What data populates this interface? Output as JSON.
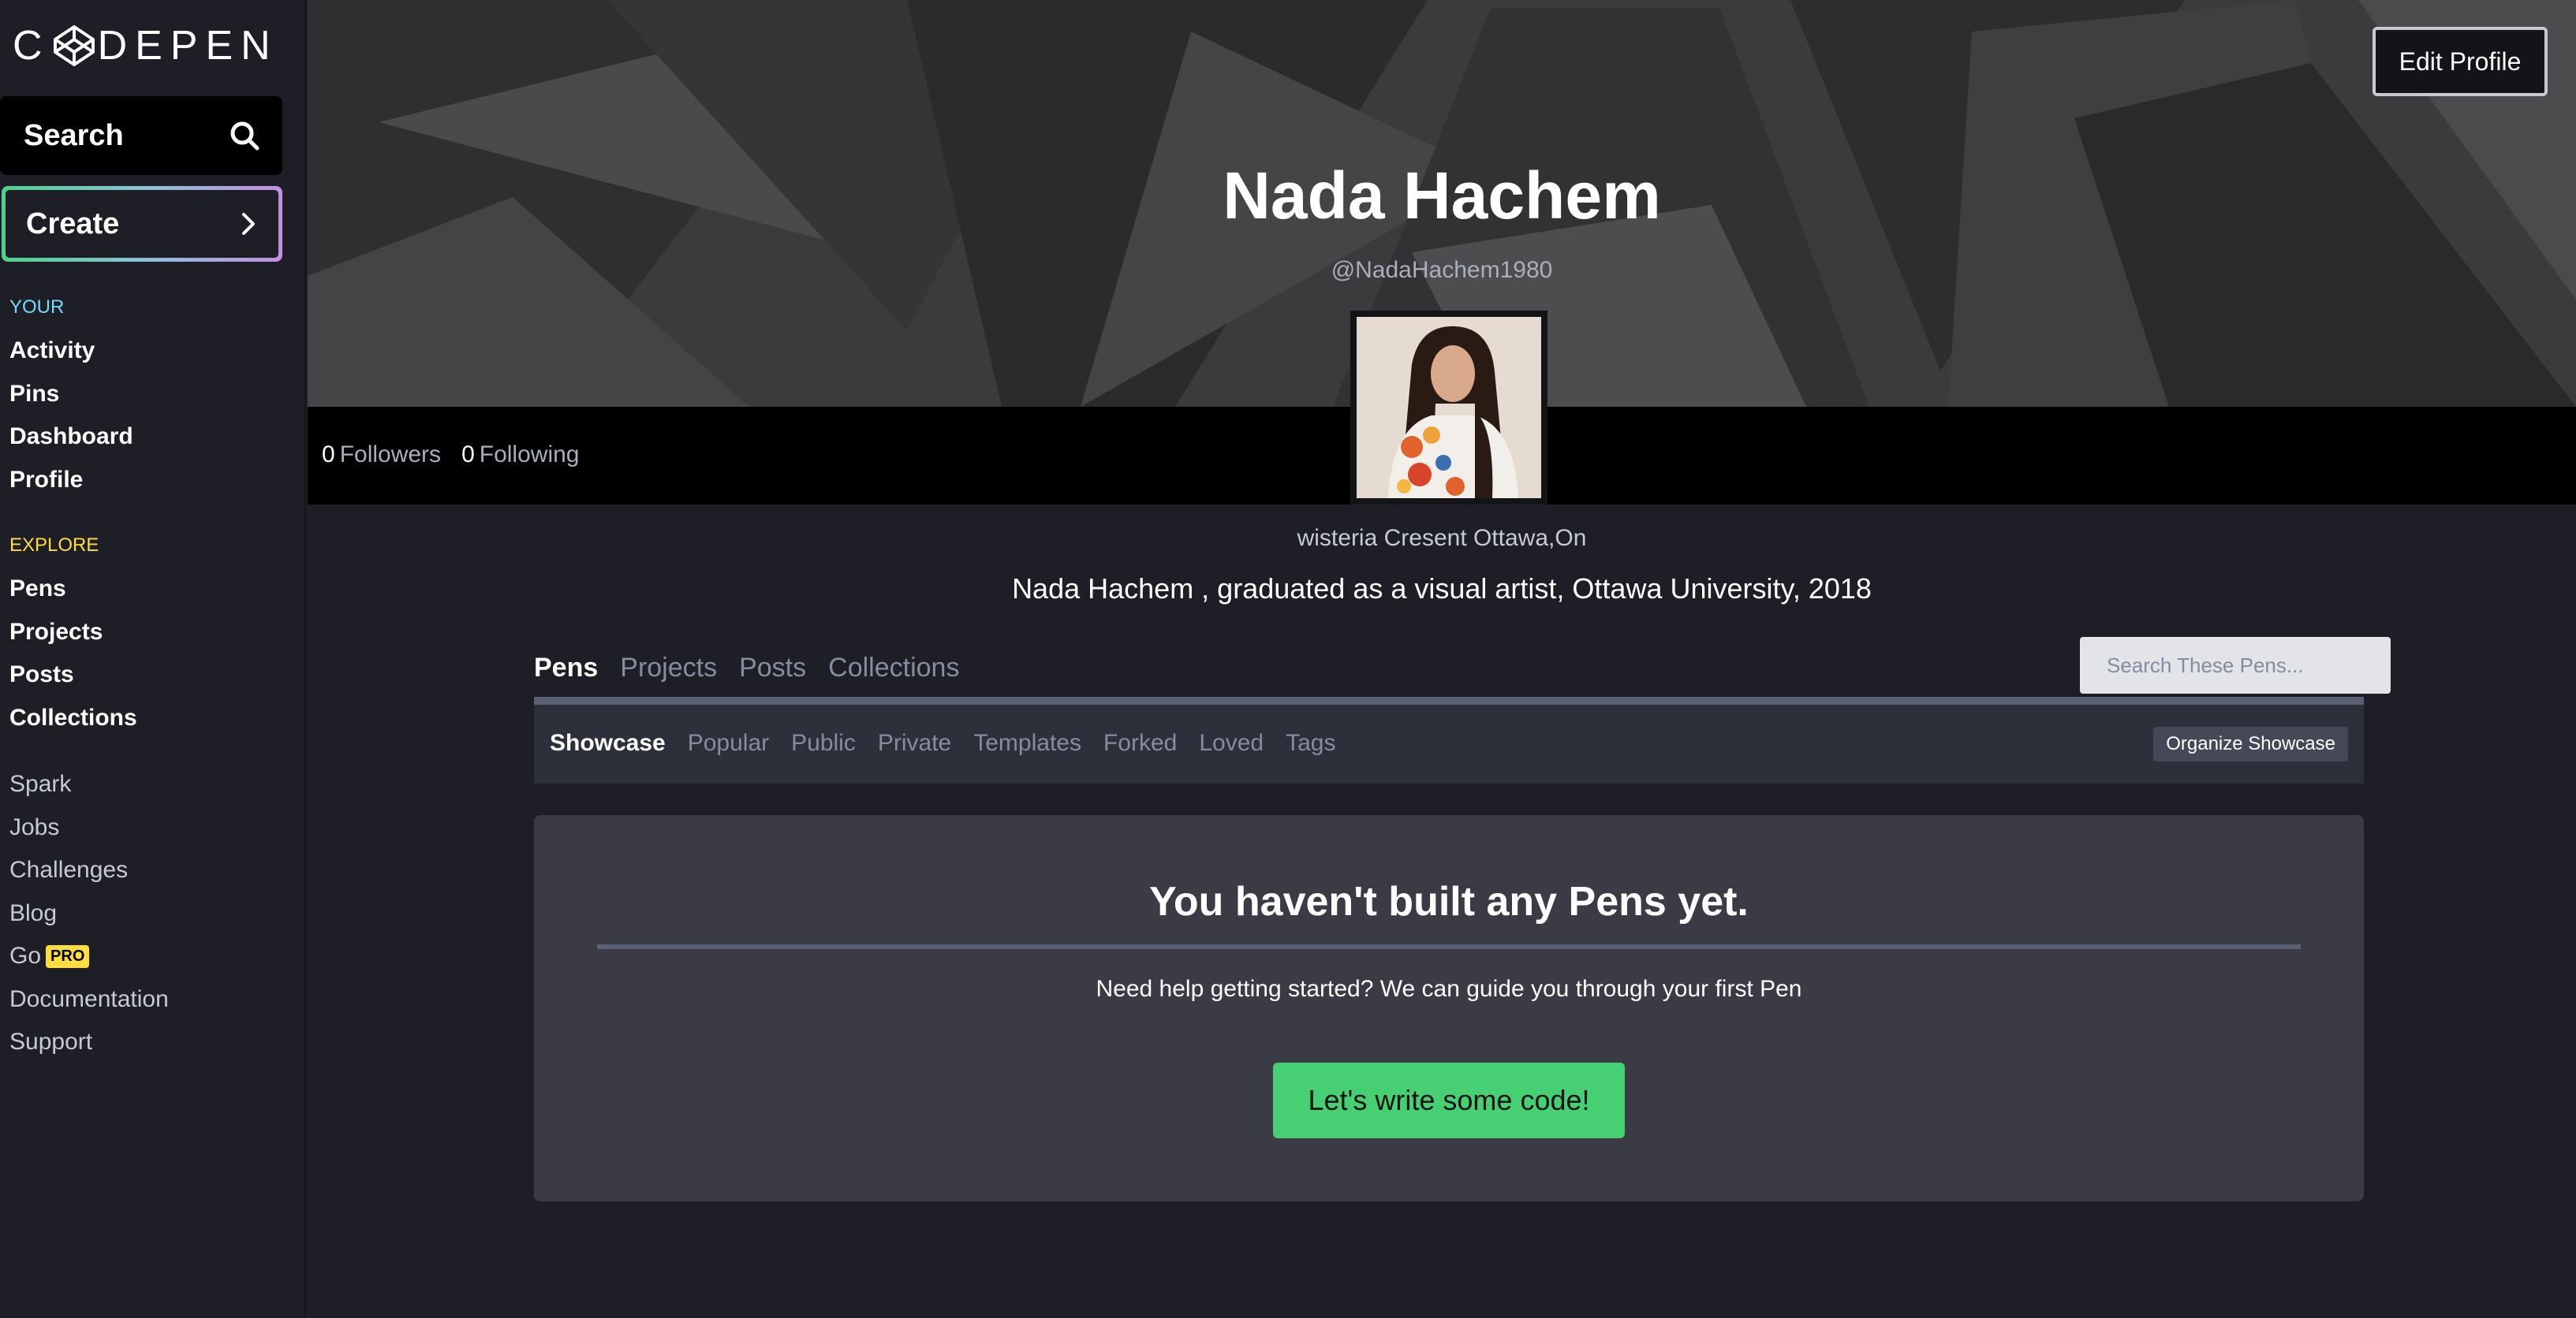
{
  "sidebar": {
    "logo_text": "CODEPEN",
    "search_label": "Search",
    "create_label": "Create",
    "your_heading": "YOUR",
    "your_items": [
      "Activity",
      "Pins",
      "Dashboard",
      "Profile"
    ],
    "explore_heading": "EXPLORE",
    "explore_items": [
      "Pens",
      "Projects",
      "Posts",
      "Collections"
    ],
    "more_items": [
      "Spark",
      "Jobs",
      "Challenges",
      "Blog",
      "Go",
      "Documentation",
      "Support"
    ],
    "pro_badge": "PRO"
  },
  "header": {
    "edit_profile_label": "Edit Profile",
    "name": "Nada Hachem",
    "handle": "@NadaHachem1980"
  },
  "stats": {
    "followers_count": "0",
    "followers_label": "Followers",
    "following_count": "0",
    "following_label": "Following"
  },
  "profile": {
    "location": "wisteria Cresent Ottawa,On",
    "bio": "Nada Hachem , graduated as a visual artist, Ottawa University, 2018"
  },
  "tabs": {
    "items": [
      "Pens",
      "Projects",
      "Posts",
      "Collections"
    ],
    "active": "Pens",
    "search_placeholder": "Search These Pens..."
  },
  "subtabs": {
    "items": [
      "Showcase",
      "Popular",
      "Public",
      "Private",
      "Templates",
      "Forked",
      "Loved",
      "Tags"
    ],
    "active": "Showcase",
    "organize_label": "Organize Showcase"
  },
  "empty_state": {
    "title": "You haven't built any Pens yet.",
    "help": "Need help getting started? We can guide you through your first Pen",
    "cta_label": "Let's write some code!"
  },
  "colors": {
    "accent_green": "#47cf73",
    "your_heading": "#76daff",
    "explore_heading": "#ffdd40"
  }
}
